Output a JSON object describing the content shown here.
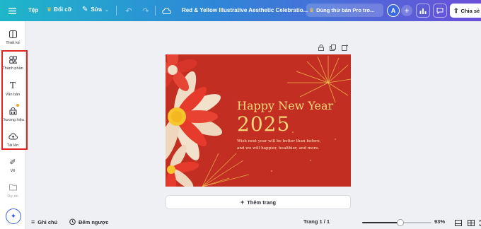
{
  "topbar": {
    "file_label": "Tệp",
    "resize_label": "Đổi cỡ",
    "edit_label": "Sửa",
    "doc_title": "Red & Yellow Illustrative Aesthetic Celebratio...",
    "pro_trial_label": "Dùng thử bản Pro tro...",
    "avatar_initial": "A",
    "share_label": "Chia sẻ"
  },
  "sidebar": {
    "items": [
      {
        "label": "Thiết kế",
        "icon": "layout-icon"
      },
      {
        "label": "Thành phần",
        "icon": "elements-icon"
      },
      {
        "label": "Văn bản",
        "icon": "text-icon"
      },
      {
        "label": "Thương hiệu",
        "icon": "brand-icon"
      },
      {
        "label": "Tải lên",
        "icon": "upload-icon"
      },
      {
        "label": "Vẽ",
        "icon": "draw-icon"
      },
      {
        "label": "Dự án",
        "icon": "folder-icon"
      }
    ]
  },
  "design": {
    "headline": "Happy New Year",
    "year": "2025",
    "wish_line1": "Wish next year will be better than before,",
    "wish_line2": "and we will happier, healthier, and more."
  },
  "add_page_label": "Thêm trang",
  "bottombar": {
    "notes_label": "Ghi chú",
    "timer_label": "Đếm ngược",
    "page_indicator": "Trang 1 / 1",
    "zoom_label": "93%",
    "zoom_value": 93
  },
  "colors": {
    "design_background": "#c22f22",
    "design_text": "#f7d77a",
    "highlight": "#e02424"
  }
}
